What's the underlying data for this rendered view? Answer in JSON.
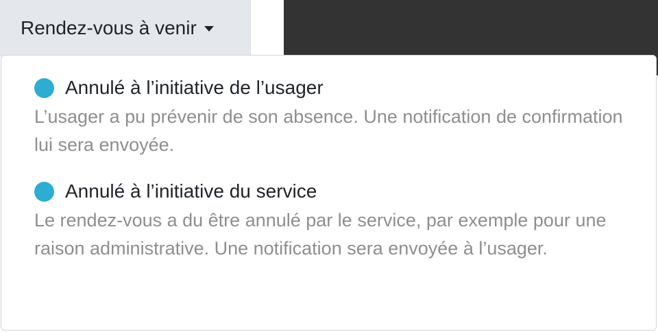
{
  "toggle": {
    "label": "Rendez-vous à venir"
  },
  "menu": {
    "items": [
      {
        "title": "Annulé à l’initiative de l’usager",
        "description": "L’usager a pu prévenir de son absence. Une notification de confirmation lui sera envoyée."
      },
      {
        "title": "Annulé à l’initiative du service",
        "description": "Le rendez-vous a du être annulé par le service, par exemple pour une raison administrative. Une notification sera envoyée à l’usager."
      }
    ]
  },
  "colors": {
    "status_dot": "#2eadd3",
    "toggle_bg": "#e4e8ed",
    "dark_panel": "#333333",
    "description_text": "#8e8e8e"
  }
}
